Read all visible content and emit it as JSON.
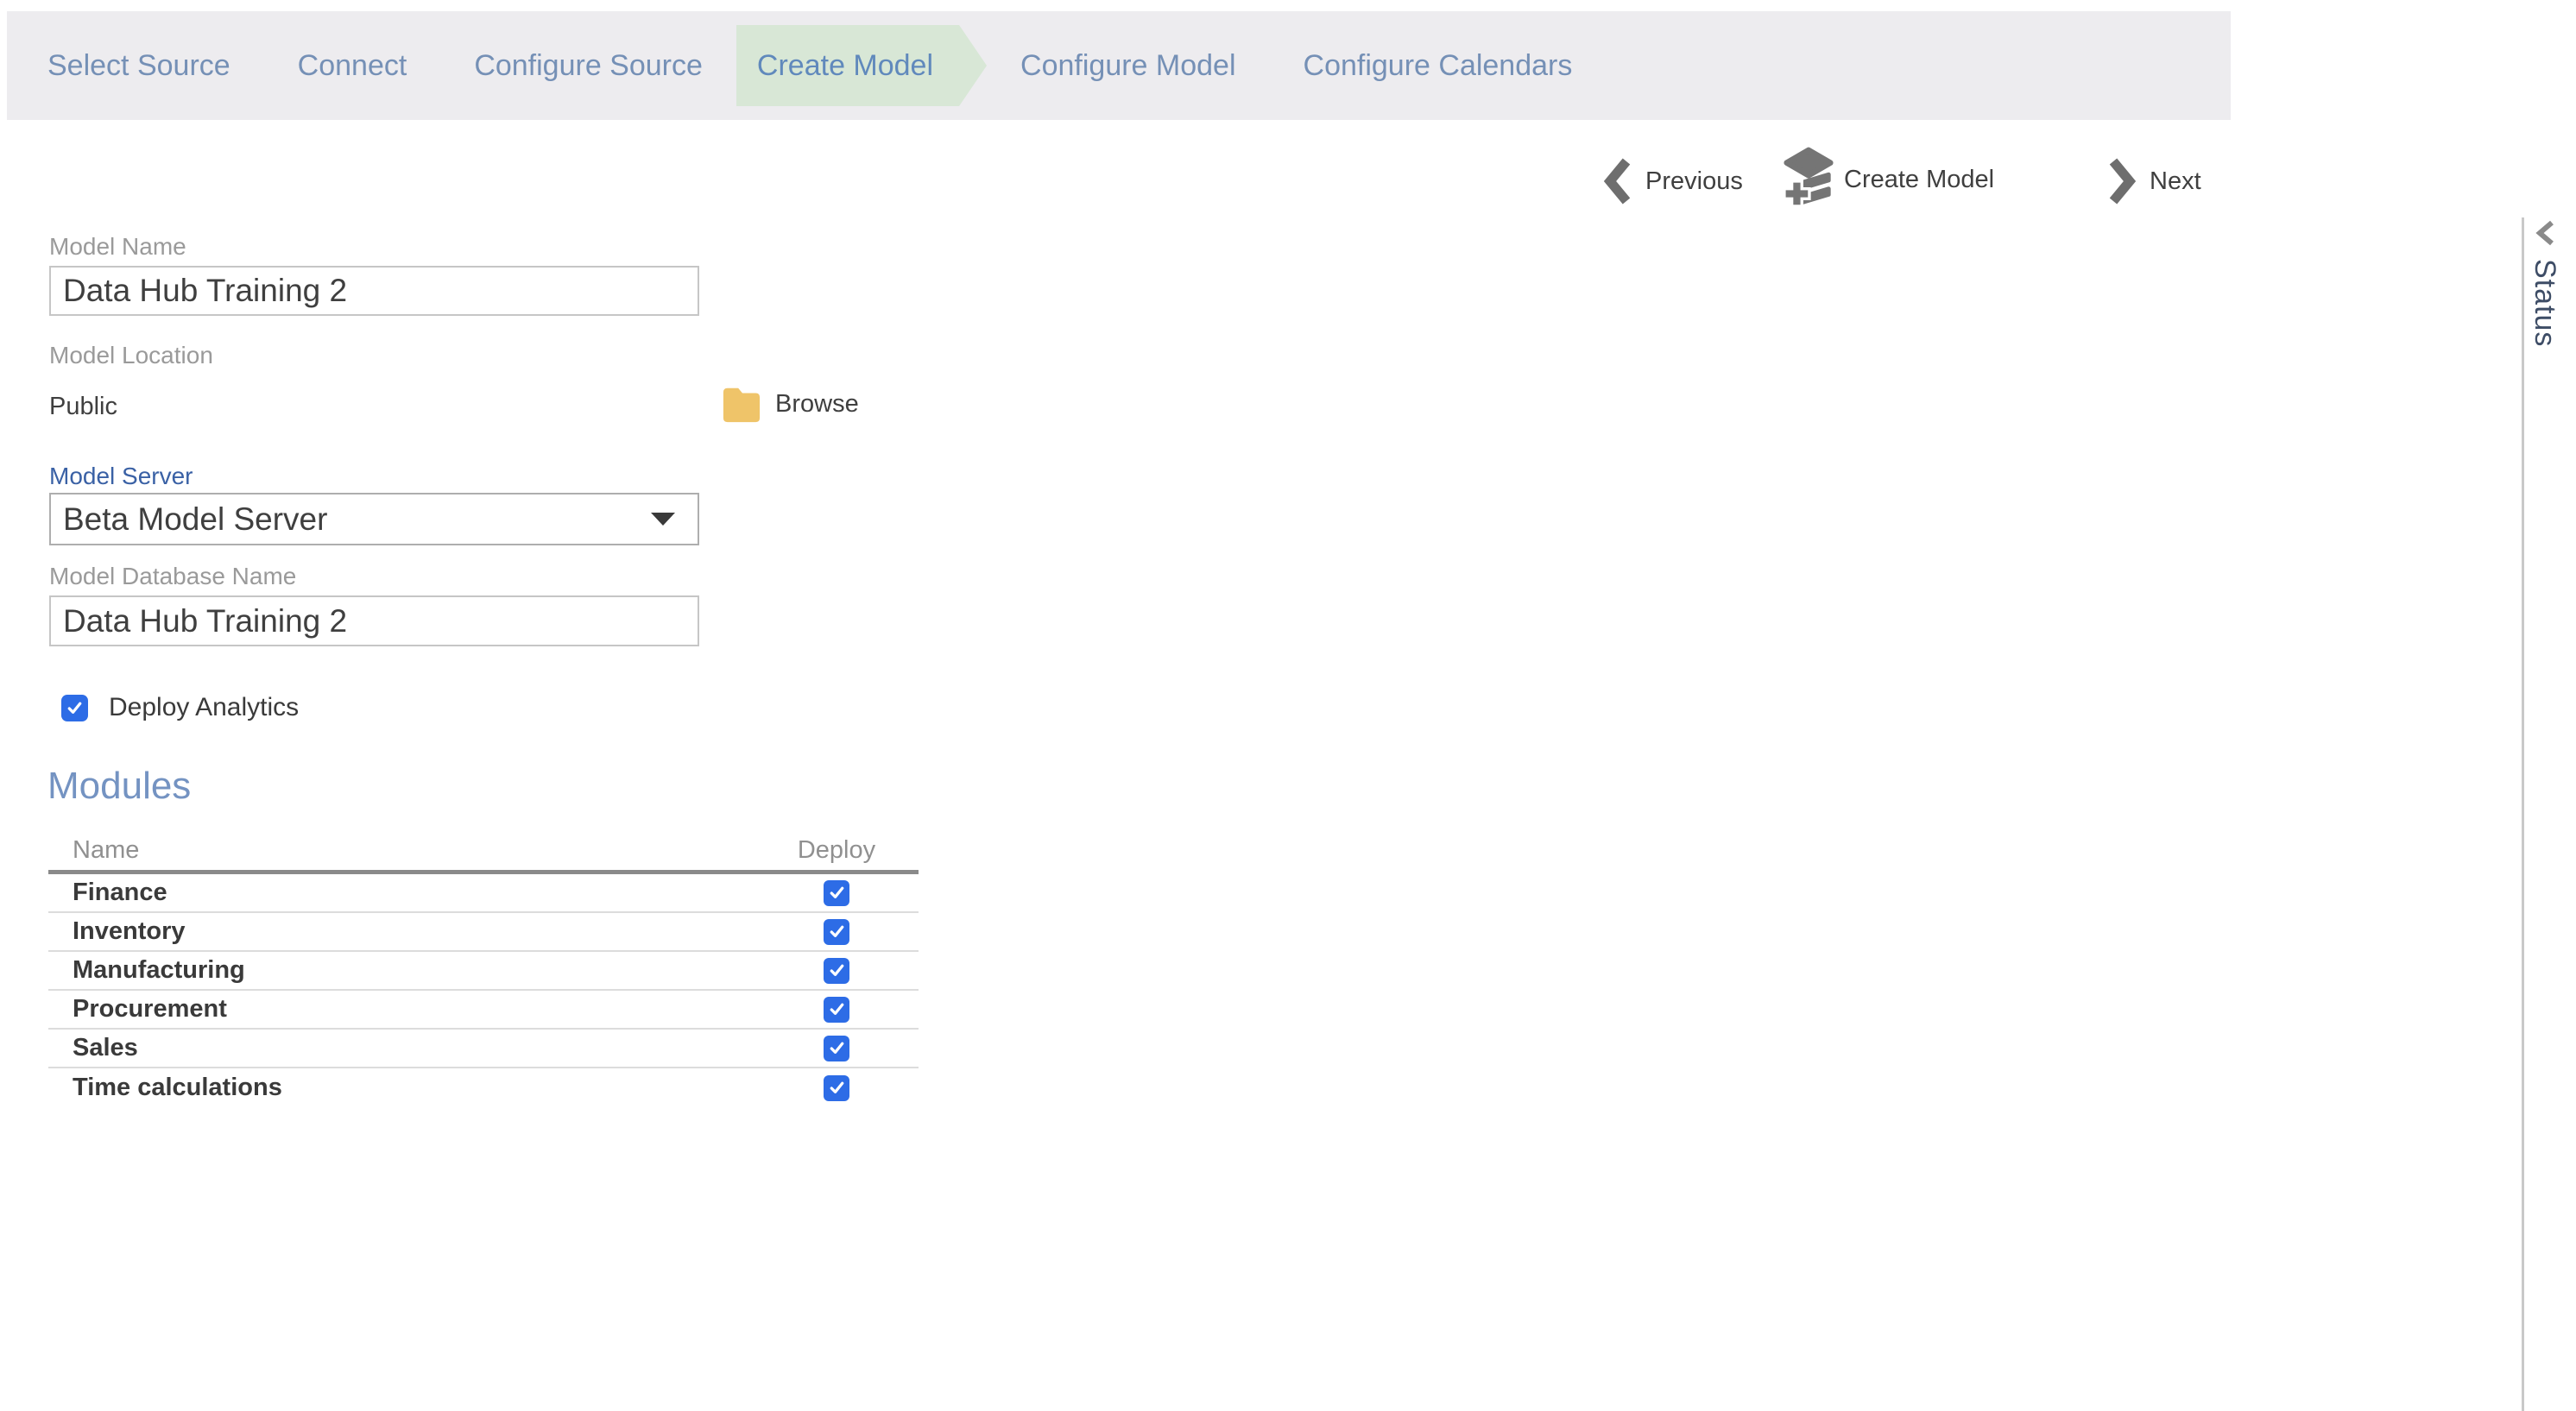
{
  "wizard": {
    "steps": [
      {
        "id": "select-source",
        "label": "Select Source",
        "active": false
      },
      {
        "id": "connect",
        "label": "Connect",
        "active": false
      },
      {
        "id": "configure-source",
        "label": "Configure Source",
        "active": false
      },
      {
        "id": "create-model",
        "label": "Create Model",
        "active": true
      },
      {
        "id": "configure-model",
        "label": "Configure Model",
        "active": false
      },
      {
        "id": "configure-calendars",
        "label": "Configure Calendars",
        "active": false
      }
    ]
  },
  "toolbar": {
    "previous_label": "Previous",
    "create_model_label": "Create Model",
    "next_label": "Next"
  },
  "form": {
    "model_name": {
      "label": "Model Name",
      "value": "Data Hub Training 2"
    },
    "model_location": {
      "label": "Model Location",
      "value": "Public",
      "browse_label": "Browse"
    },
    "model_server": {
      "label": "Model Server",
      "value": "Beta Model Server"
    },
    "model_database_name": {
      "label": "Model Database Name",
      "value": "Data Hub Training 2"
    },
    "deploy_analytics": {
      "label": "Deploy Analytics",
      "checked": true
    }
  },
  "modules": {
    "heading": "Modules",
    "columns": {
      "name": "Name",
      "deploy": "Deploy"
    },
    "rows": [
      {
        "name": "Finance",
        "deploy": true
      },
      {
        "name": "Inventory",
        "deploy": true
      },
      {
        "name": "Manufacturing",
        "deploy": true
      },
      {
        "name": "Procurement",
        "deploy": true
      },
      {
        "name": "Sales",
        "deploy": true
      },
      {
        "name": "Time calculations",
        "deploy": true
      }
    ]
  },
  "status_panel": {
    "label": "Status"
  },
  "colors": {
    "step_bar_bg": "#edecef",
    "active_step_bg": "#d8e7d6",
    "step_text": "#7590b6",
    "active_step_text": "#6089bc",
    "checkbox_blue": "#2d6ce6",
    "blue_label": "#3a61a5",
    "modules_heading": "#7493c2",
    "folder_yellow": "#efc469",
    "toolbar_icon_gray": "#757575",
    "status_text": "#3e4d66"
  }
}
